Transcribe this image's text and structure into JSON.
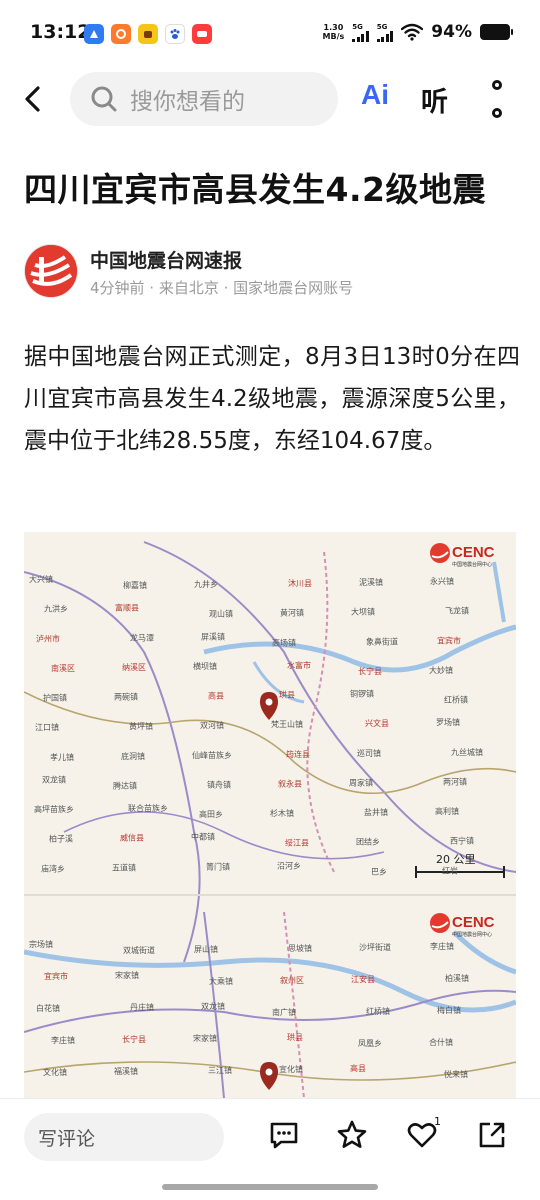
{
  "status_bar": {
    "time": "13:12",
    "net_speed_value": "1.30",
    "net_speed_unit": "MB/s",
    "signal_1_label": "5G",
    "signal_2_label": "5G",
    "battery_percent": "94%"
  },
  "nav": {
    "search_placeholder": "搜你想看的",
    "ai_label": "Ai",
    "listen_label": "听"
  },
  "article": {
    "title": "四川宜宾市高县发生4.2级地震",
    "author_name": "中国地震台网速报",
    "author_meta": "4分钟前 · 来自北京 · 国家地震台网账号",
    "body": "据中国地震台网正式测定，8月3日13时0分在四川宜宾市高县发生4.2级地震，震源深度5公里，震中位于北纬28.55度，东经104.67度。"
  },
  "map": {
    "logo_text": "CENC",
    "logo_sub": "中国地震台网中心",
    "scale_label": "20 公里",
    "places_top": [
      "大兴镇",
      "柳嘉镇",
      "九井乡",
      "沐川县",
      "泥溪镇",
      "永兴镇",
      "九洪乡",
      "富顺县",
      "观山镇",
      "黄河镇",
      "大坝镇",
      "飞龙镇",
      "泸州市",
      "龙马潭",
      "屏溪镇",
      "高场镇",
      "象鼻街道",
      "宜宾市",
      "南溪区",
      "纳溪区",
      "横坝镇",
      "水富市",
      "长宁县",
      "大妙镇",
      "护国镇",
      "两碗镇",
      "高县",
      "珙县",
      "铜锣镇",
      "红桥镇",
      "江口镇",
      "黄坪镇",
      "双河镇",
      "梵王山镇",
      "兴文县",
      "罗场镇",
      "孝儿镇",
      "底洞镇",
      "仙峰苗族乡",
      "筠连县",
      "巡司镇",
      "九丝城镇",
      "双龙镇",
      "腾达镇",
      "镇舟镇",
      "叙永县",
      "周家镇",
      "两河镇",
      "高坪苗族乡",
      "联合苗族乡",
      "高田乡",
      "杉木镇",
      "盐井镇",
      "高利镇",
      "柏子溪",
      "威信县",
      "中都镇",
      "绥江县",
      "团结乡",
      "西宁镇",
      "庙湾乡",
      "五道镇",
      "箐门镇",
      "沿河乡",
      "巴乡",
      "红岩"
    ],
    "places_bottom": [
      "宗场镇",
      "双城街道",
      "屏山镇",
      "思坡镇",
      "沙坪街道",
      "李庄镇",
      "宜宾市",
      "宋家镇",
      "大乘镇",
      "叙州区",
      "江安县",
      "柏溪镇",
      "白花镇",
      "丹庄镇",
      "双龙镇",
      "南广镇",
      "红桥镇",
      "梅白镇",
      "李庄镇",
      "长宁县",
      "宋家镇",
      "珙县",
      "凤凰乡",
      "合什镇",
      "文化镇",
      "福溪镇",
      "三江镇",
      "宣化镇",
      "高县",
      "悦来镇"
    ]
  },
  "bottom_bar": {
    "comment_placeholder": "写评论",
    "like_count": "1"
  }
}
